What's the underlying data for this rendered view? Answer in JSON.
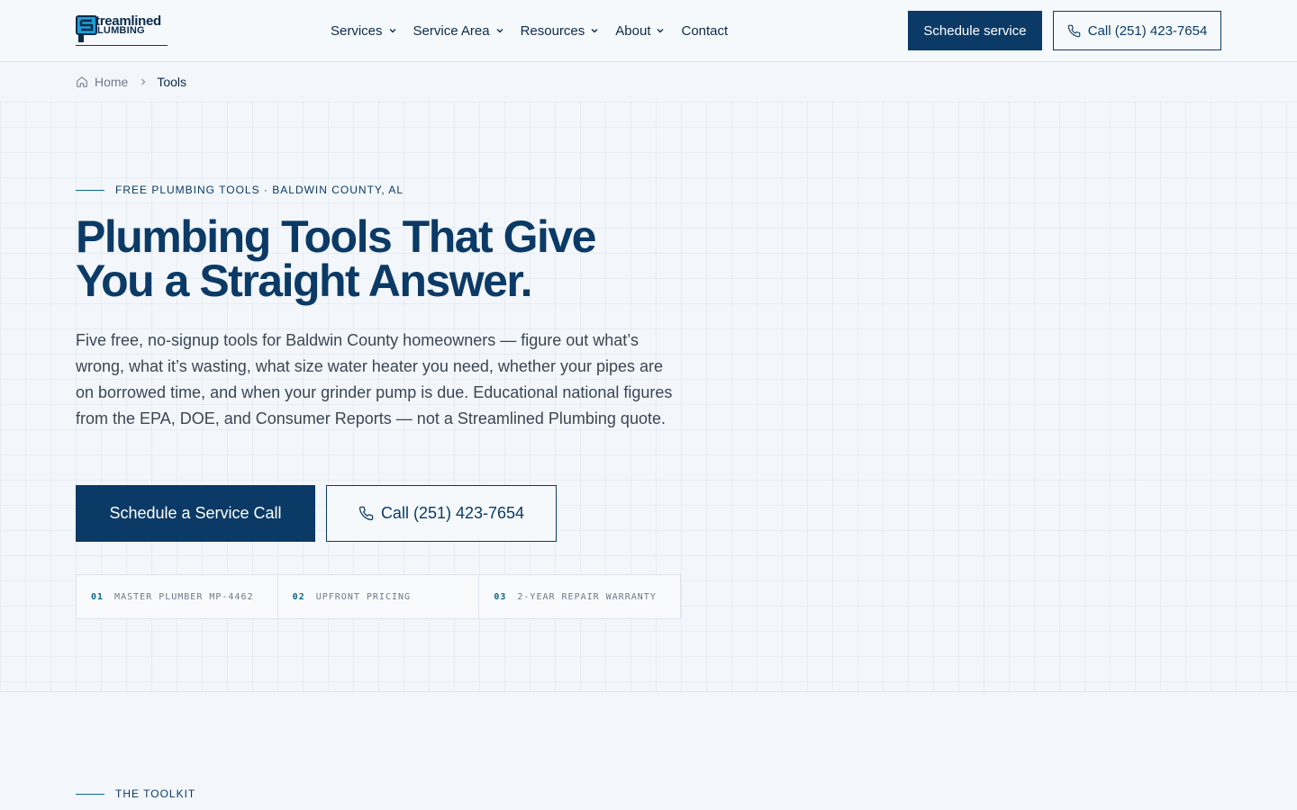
{
  "header": {
    "logo": {
      "line1": "treamlined",
      "line2": "LUMBING"
    },
    "nav": [
      {
        "label": "Services",
        "has_dropdown": true,
        "icon": "chevron-down-icon"
      },
      {
        "label": "Service Area",
        "has_dropdown": true,
        "icon": "chevron-down-icon"
      },
      {
        "label": "Resources",
        "has_dropdown": true,
        "icon": "chevron-down-icon"
      },
      {
        "label": "About",
        "has_dropdown": true,
        "icon": "chevron-down-icon"
      },
      {
        "label": "Contact",
        "has_dropdown": false
      }
    ],
    "schedule_label": "Schedule service",
    "call_label": "Call (251) 423-7654"
  },
  "breadcrumb": {
    "home": "Home",
    "current": "Tools"
  },
  "hero": {
    "eyebrow": "FREE PLUMBING TOOLS · BALDWIN COUNTY, AL",
    "title": "Plumbing Tools That Give You a Straight Answer.",
    "description": "Five free, no-signup tools for Baldwin County homeowners — figure out what’s wrong, what it’s wasting, what size water heater you need, whether your pipes are on borrowed time, and when your grinder pump is due. Educational national figures from the EPA, DOE, and Consumer Reports — not a Streamlined Plumbing quote.",
    "schedule_label": "Schedule a Service Call",
    "call_label": "Call (251) 423-7654",
    "badges": [
      {
        "num": "01",
        "label": "MASTER PLUMBER MP-4462"
      },
      {
        "num": "02",
        "label": "UPFRONT PRICING"
      },
      {
        "num": "03",
        "label": "2-YEAR REPAIR WARRANTY"
      }
    ]
  },
  "toolkit": {
    "eyebrow": "THE TOOLKIT"
  },
  "colors": {
    "brand_navy": "#0b3a66",
    "accent_teal": "#0b6a8a",
    "background": "#f3f7fb"
  }
}
